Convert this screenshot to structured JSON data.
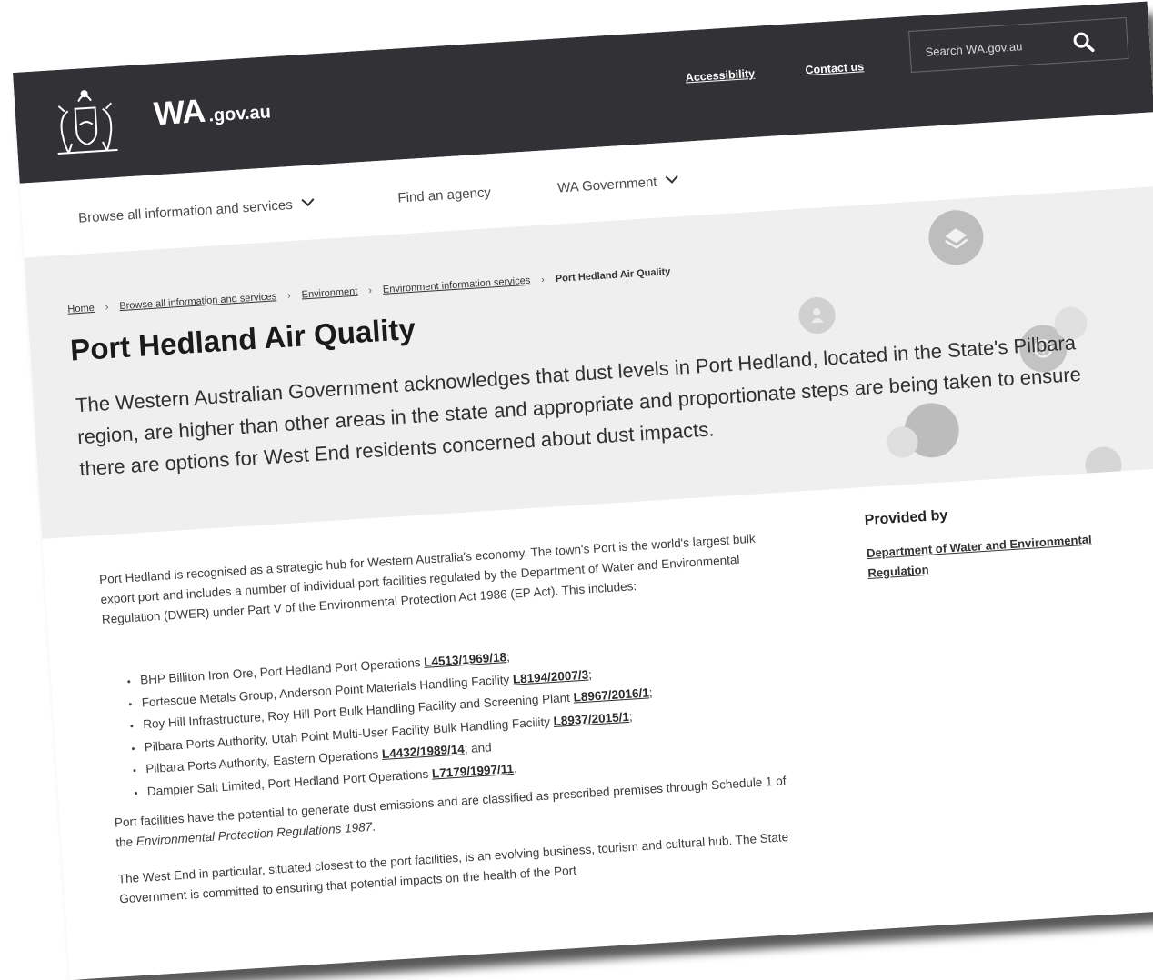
{
  "header": {
    "brand_main": "WA",
    "brand_domain": ".gov.au",
    "links": [
      "Accessibility",
      "Contact us"
    ],
    "search_placeholder": "Search WA.gov.au"
  },
  "nav": {
    "items": [
      "Browse all information and services",
      "Find an agency",
      "WA Government"
    ]
  },
  "breadcrumb": {
    "items": [
      "Home",
      "Browse all information and services",
      "Environment",
      "Environment information services"
    ],
    "current": "Port Hedland Air Quality"
  },
  "page": {
    "title": "Port Hedland Air Quality",
    "lead": "The Western Australian Government acknowledges that dust levels in Port Hedland, located in the State's Pilbara region, are higher than other areas in the state and appropriate and proportionate steps are being taken to ensure there are options for West End residents concerned about dust impacts."
  },
  "body": {
    "intro": "Port Hedland is recognised as a strategic hub for Western Australia's economy. The town's Port is the world's largest bulk export port and includes a number of individual port facilities regulated by the Department of Water and Environmental Regulation (DWER) under Part V of the Environmental Protection Act 1986 (EP Act). This includes:",
    "licences": [
      {
        "text": "BHP Billiton Iron Ore, Port Hedland Port Operations ",
        "link": "L4513/1969/18",
        "after": ";"
      },
      {
        "text": "Fortescue Metals Group, Anderson Point Materials Handling Facility ",
        "link": "L8194/2007/3",
        "after": ";"
      },
      {
        "text": "Roy Hill Infrastructure, Roy Hill Port Bulk Handling Facility and Screening Plant ",
        "link": "L8967/2016/1",
        "after": ";"
      },
      {
        "text": "Pilbara Ports Authority, Utah Point Multi-User Facility Bulk Handling Facility ",
        "link": "L8937/2015/1",
        "after": ";"
      },
      {
        "text": "Pilbara Ports Authority, Eastern Operations ",
        "link": "L4432/1989/14",
        "after": "; and"
      },
      {
        "text": "Dampier Salt Limited, Port Hedland Port Operations ",
        "link": "L7179/1997/11",
        "after": "."
      }
    ],
    "para2_start": "Port facilities have the potential to generate dust emissions and are classified as prescribed premises through Schedule 1 of the ",
    "para2_italic": "Environmental Protection Regulations 1987",
    "para2_end": ".",
    "para3": "The West End in particular, situated closest to the port facilities, is an evolving business, tourism and cultural hub. The State Government is committed to ensuring that potential impacts on the health of the Port"
  },
  "sidebar": {
    "heading": "Provided by",
    "provider": "Department of Water and Environmental Regulation"
  },
  "colors": {
    "header_bg": "#323236",
    "hero_bg": "#efefef",
    "text": "#2b2b2b"
  },
  "icons": [
    "crest-logo-icon",
    "search-icon",
    "chevron-down-icon",
    "layers-icon",
    "user-icon",
    "info-icon",
    "bubble-icon"
  ]
}
